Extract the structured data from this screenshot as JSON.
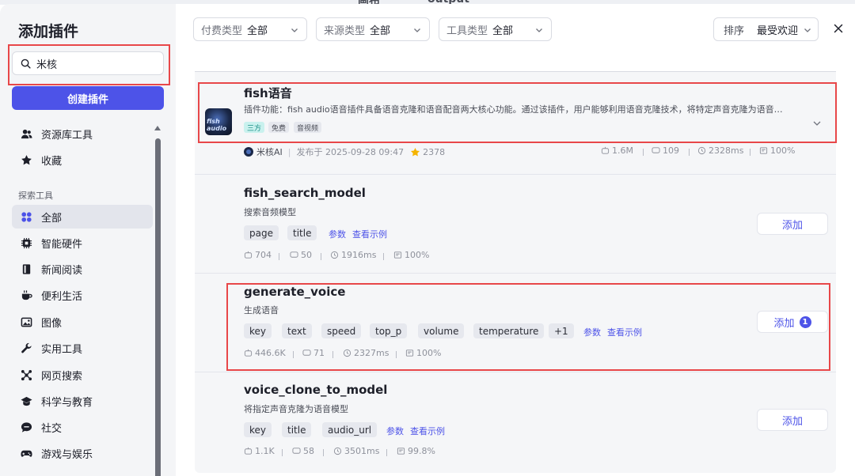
{
  "backdrop": {
    "text_left": "画布",
    "text_right": "output"
  },
  "sidebar": {
    "title": "添加插件",
    "search_value": "米核",
    "create_label": "创建插件",
    "top_items": [
      {
        "label": "资源库工具",
        "icon": "users-icon"
      },
      {
        "label": "收藏",
        "icon": "star-icon"
      }
    ],
    "section_label": "探索工具",
    "categories": [
      {
        "label": "全部",
        "icon": "grid-icon",
        "active": true
      },
      {
        "label": "智能硬件",
        "icon": "chip-icon"
      },
      {
        "label": "新闻阅读",
        "icon": "book-icon"
      },
      {
        "label": "便利生活",
        "icon": "cup-icon"
      },
      {
        "label": "图像",
        "icon": "image-icon"
      },
      {
        "label": "实用工具",
        "icon": "wrench-icon"
      },
      {
        "label": "网页搜索",
        "icon": "network-icon"
      },
      {
        "label": "科学与教育",
        "icon": "graduation-cap-icon"
      },
      {
        "label": "社交",
        "icon": "chat-icon"
      },
      {
        "label": "游戏与娱乐",
        "icon": "gamepad-icon"
      }
    ]
  },
  "filters": {
    "pay": {
      "label": "付费类型",
      "value": "全部"
    },
    "source": {
      "label": "来源类型",
      "value": "全部"
    },
    "tool": {
      "label": "工具类型",
      "value": "全部"
    },
    "sort": {
      "label": "排序",
      "value": "最受欢迎"
    }
  },
  "plugin": {
    "name": "fish语音",
    "description": "插件功能：fish audio语音插件具备语音克隆和语音配音两大核心功能。通过该插件，用户能够利用语音克隆技术，将特定声音克隆为语音…",
    "tags": [
      "三方",
      "免费",
      "音视频"
    ],
    "publisher": "米核AI",
    "published": "发布于 2025-09-28 09:47",
    "stars": "2378",
    "stats": [
      "1.6M",
      "109",
      "2328ms",
      "100%"
    ]
  },
  "tools": [
    {
      "name": "fish_search_model",
      "description": "搜索音频模型",
      "params": [
        "page",
        "title"
      ],
      "params_link": "参数",
      "example_link": "查看示例",
      "stats": [
        "704",
        "50",
        "1916ms",
        "100%"
      ],
      "add_label": "添加"
    },
    {
      "name": "generate_voice",
      "description": "生成语音",
      "params": [
        "key",
        "text",
        "speed",
        "top_p",
        "volume",
        "temperature",
        "+1"
      ],
      "params_link": "参数",
      "example_link": "查看示例",
      "stats": [
        "446.6K",
        "71",
        "2327ms",
        "100%"
      ],
      "add_label": "添加",
      "badge": "1"
    },
    {
      "name": "voice_clone_to_model",
      "description": "将指定声音克隆为语音模型",
      "params": [
        "key",
        "title",
        "audio_url"
      ],
      "params_link": "参数",
      "example_link": "查看示例",
      "stats": [
        "1.1K",
        "58",
        "3501ms",
        "99.8%"
      ],
      "add_label": "添加"
    }
  ],
  "colors": {
    "accent": "#4d53e8",
    "highlight": "#e84749",
    "star": "#f5b400"
  }
}
